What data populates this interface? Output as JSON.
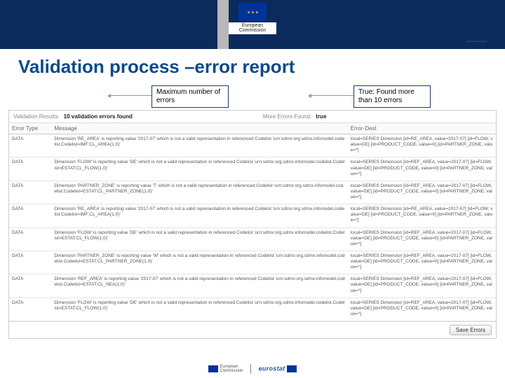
{
  "header": {
    "org_line1": "European",
    "org_line2": "Commission"
  },
  "slide": {
    "title": "Validation process –error report"
  },
  "callouts": {
    "left": "Maximum number of errors",
    "right": "True: Found more than 10 errors"
  },
  "panel": {
    "results_label": "Validation Results:",
    "results_value": "10 validation errors found",
    "more_label": "More Errors Found:",
    "more_value": "true",
    "columns": {
      "type": "Error Type",
      "message": "Message",
      "dest": "Error-Dest"
    },
    "rows": [
      {
        "type": "DATA",
        "msg": "Dimension 'RE_AREA' is reporting value '2017-07' which is not a valid representation in referenced Codelist 'urn:sdmx:org.sdmx.infomodel.codelist.Codelist=IMF:CL_AREA(1.0)'",
        "dest": "local=SERIES Dimension [id=RE_AREA, value=2017-07] [id=FLOW, value=DE] [id=PRODUCT_CODE, value=0] [id=PARTNER_ZONE, value=*]"
      },
      {
        "type": "DATA",
        "msg": "Dimension 'FLOW' is reporting value 'DE' which is not a valid representation in referenced Codelist 'urn:sdmx:org.sdmx.infomodel.codelist.Codelist=ESTAT:CL_FLOW(1.0)'",
        "dest": "local=SERIES Dimension [id=REF_AREA, value=2017-07] [id=FLOW, value=DE] [id=PRODUCT_CODE, value=0] [id=PARTNER_ZONE, value=*]"
      },
      {
        "type": "DATA",
        "msg": "Dimension 'PARTNER_ZONE' is reporting value 'T' which is not a valid representation in referenced Codelist 'urn:sdmx:org.sdmx.infomodel.codelist.Codelist=ESTAT:CL_PARTNER_ZONE(1.0)'",
        "dest": "local=SERIES Dimension [id=REF_AREA, value=2017-07] [id=FLOW, value=DE] [id=PRODUCT_CODE, value=0] [id=PARTNER_ZONE, value=*]"
      },
      {
        "type": "DATA",
        "msg": "Dimension 'RE_AREA' is reporting value '2017-07' which is not a valid representation in referenced Codelist 'urn:sdmx:org.sdmx.infomodel.codelist.Codelist=IMF:CL_AREA(1.0)'",
        "dest": "local=SERIES Dimension [id=RE_AREA, value=2017-07] [id=FLOW, value=DE] [id=PRODUCT_CODE, value=0] [id=PARTNER_ZONE, value=*]"
      },
      {
        "type": "DATA",
        "msg": "Dimension 'FLOW' is reporting value 'DE' which is not a valid representation in referenced Codelist 'urn:sdmx:org.sdmx.infomodel.codelist.Codelist=ESTAT:CL_FLOW(1.0)'",
        "dest": "local=SERIES Dimension [id=REF_AREA, value=2017-07] [id=FLOW, value=DE] [id=PRODUCT_CODE, value=0] [id=PARTNER_ZONE, value=*]"
      },
      {
        "type": "DATA",
        "msg": "Dimension 'PARTNER_ZONE' is reporting value 'W' which is not a valid representation in referenced Codelist 'urn:sdmx:org.sdmx.infomodel.codelist.Codelist=ESTAT:CL_PARTNER_ZONE(1.0)'",
        "dest": "local=SERIES Dimension [id=REF_AREA, value=2017-07] [id=FLOW, value=DE] [id=PRODUCT_CODE, value=0] [id=PARTNER_ZONE, value=*]"
      },
      {
        "type": "DATA",
        "msg": "Dimension 'REF_AREA' is reporting value '2017-07' which is not a valid representation in referenced Codelist 'urn:sdmx:org.sdmx.infomodel.codelist.Codelist=ESTAT:CL_NEA(1.0)'",
        "dest": "local=SERIES Dimension [id=REF_AREA, value=2017-07] [id=FLOW, value=DE] [id=PRODUCT_CODE, value=0] [id=PARTNER_ZONE, value=*]"
      },
      {
        "type": "DATA",
        "msg": "Dimension 'FLOW' is reporting value 'DE' which is not a valid representation in referenced Codelist 'urn:sdmx:org.sdmx.infomodel.codelist.Codelist=ESTAT:CL_FLOW(1.0)'",
        "dest": "local=SERIES Dimension [id=REF_AREA, value=2017-07] [id=FLOW, value=DE] [id=PRODUCT_CODE, value=0] [id=PARTNER_ZONE, value=*]"
      }
    ],
    "save_label": "Save Errors"
  },
  "footer": {
    "eurostat": "eurostat",
    "ec_line1": "European",
    "ec_line2": "Commission"
  }
}
